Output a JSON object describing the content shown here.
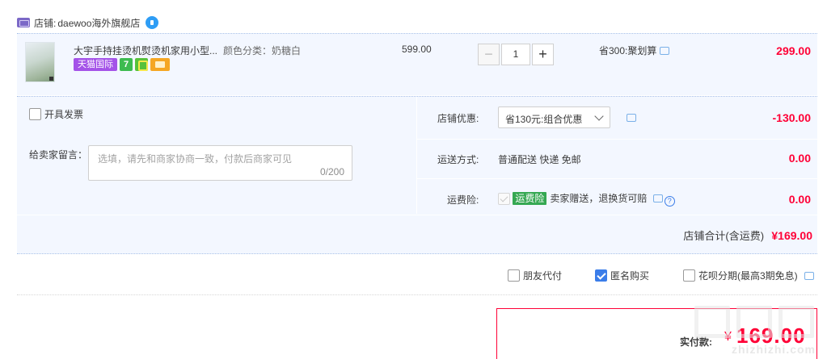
{
  "shop": {
    "label": "店铺:",
    "name": "daewoo海外旗舰店"
  },
  "item": {
    "title": "大宇手持挂烫机熨烫机家用小型...",
    "sku": "颜色分类：奶糖白",
    "badges": {
      "tmall": "天猫国际",
      "seven": "7"
    },
    "price": "599.00",
    "quantity": "1",
    "promo": "省300:聚划算",
    "total": "299.00"
  },
  "options": {
    "invoice_label": "开具发票",
    "message_label": "给卖家留言：",
    "message_placeholder": "选填，请先和商家协商一致，付款后商家可见",
    "message_count": "0/200",
    "discount": {
      "label": "店铺优惠:",
      "selected": "省130元:组合优惠",
      "amount": "-130.00"
    },
    "shipping": {
      "label": "运送方式:",
      "value": "普通配送 快递 免邮",
      "amount": "0.00"
    },
    "insurance": {
      "label": "运费险:",
      "badge": "运费险",
      "value": "卖家赠送，退换货可赔",
      "amount": "0.00"
    },
    "subtotal": {
      "label": "店铺合计(含运费)",
      "amount": "¥169.00"
    }
  },
  "payment_options": {
    "friend_pay": "朋友代付",
    "anonymous": "匿名购买",
    "huabei": "花呗分期(最高3期免息)"
  },
  "final": {
    "label": "实付款:",
    "currency": "¥",
    "amount": "169.00"
  },
  "watermark": "zhizhizhi.com",
  "colors": {
    "price_red": "#ff0036",
    "panel_bg": "#f3f7ff",
    "check_blue": "#3b7de9",
    "tmall_purple": "#a453e8"
  }
}
